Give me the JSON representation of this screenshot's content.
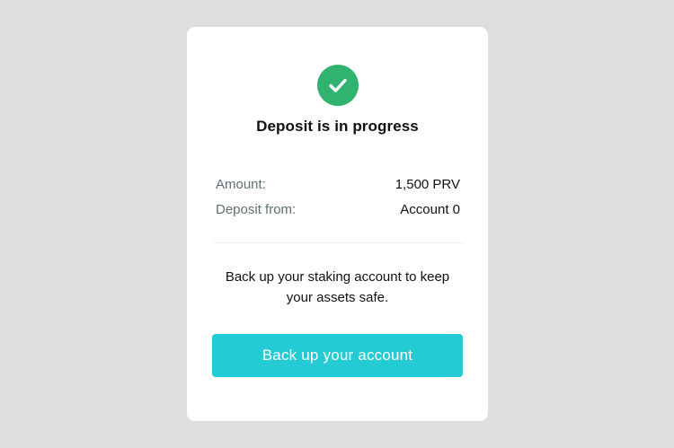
{
  "colors": {
    "background": "#dedede",
    "card": "#ffffff",
    "success": "#2fb36e",
    "accent": "#25cbd4",
    "label": "#5f6f72",
    "text": "#111111"
  },
  "status": {
    "icon": "check-circle-icon",
    "title": "Deposit is in progress"
  },
  "details": [
    {
      "label": "Amount:",
      "value": "1,500 PRV"
    },
    {
      "label": "Deposit from:",
      "value": "Account 0"
    }
  ],
  "message": "Back up your staking account to keep your assets safe.",
  "action": {
    "label": "Back up your account"
  }
}
